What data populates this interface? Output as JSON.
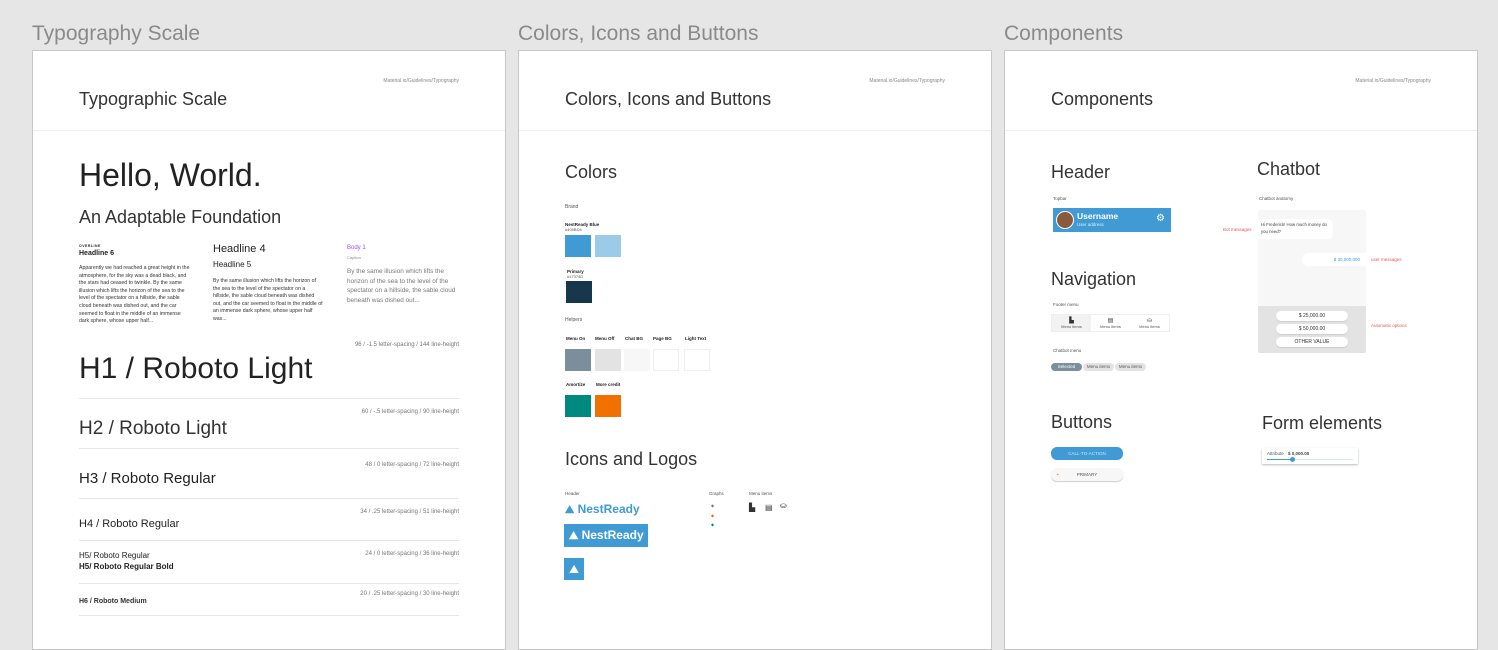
{
  "sections": [
    "Typography Scale",
    "Colors, Icons and Buttons",
    "Components"
  ],
  "typography": {
    "path": "Material.io/Guidelines/Typography",
    "title": "Typographic Scale",
    "hello": "Hello, World.",
    "subtitle": "An Adaptable Foundation",
    "col1": {
      "overline": "OVERLINE",
      "headline": "Headline 6",
      "text": "Apparently we had reached a great height in the atmosphere, for the sky was a dead black, and the stars had ceased to twinkle. By the same illusion which lifts the horizon of the sea to the level of the spectator on a hillside, the sable cloud beneath was dished out, and the car seemed to float in the middle of an immense dark sphere, whose upper half..."
    },
    "col2": {
      "h4": "Headline 4",
      "h5": "Headline 5",
      "text": "By the same illusion which lifts the horizon of the sea to the level of the spectator on a hillside, the sable cloud beneath was dished out, and the car seemed to float in the middle of an immense dark sphere, whose upper half was..."
    },
    "col3": {
      "body": "Body 1",
      "caption": "Caption",
      "text": "By the same illusion which lifts the horizon of the sea to the level of the spectator on a hillside, the sable cloud beneath was dished out..."
    },
    "scale": [
      {
        "spec": "96 / -1.5 letter-spacing / 144 line-height",
        "label": "H1 / Roboto Light"
      },
      {
        "spec": "60 / -.5 letter-spacing / 90 line-height",
        "label": "H2 / Roboto Light"
      },
      {
        "spec": "48 / 0 letter-spacing / 72 line-height",
        "label": "H3 / Roboto Regular"
      },
      {
        "spec": "34 / .25 letter-spacing / 51 line-height",
        "label": "H4 / Roboto Regular"
      },
      {
        "spec": "24 / 0 letter-spacing / 36 line-height",
        "label": "H5/ Roboto Regular",
        "label2": "H5/ Roboto Regular Bold"
      },
      {
        "spec": "20 / .25 letter-spacing / 30 line-height",
        "label": "H6 / Roboto Medium"
      }
    ]
  },
  "colors": {
    "path": "Material.io/Guidelines/Typography",
    "title": "Colors, Icons and Buttons",
    "heading": "Colors",
    "brand": "Brand",
    "blue_name": "NestReady Blue",
    "blue_hex": "#409BD4",
    "primary_name": "Primary",
    "primary_hex": "#17374D",
    "helpers": "Helpers",
    "helper_labels": [
      "Menu On",
      "Menu Off",
      "Chat BG",
      "Page BG",
      "Light Text"
    ],
    "accent_labels": [
      "Amortize",
      "More credit"
    ],
    "swatch_colors": {
      "blue": "#409bd4",
      "light_blue": "#9ccbea",
      "primary": "#17374d",
      "menu_on": "#7a8f9b",
      "menu_off": "#e3e3e3",
      "chat_bg": "#f7f7f7",
      "page_bg": "#ffffff",
      "light_text": "#ffffff",
      "amortize": "#00897f",
      "more_credit": "#f07000"
    },
    "icons_heading": "Icons and Logos",
    "header_label": "Header",
    "graphs_label": "Graphs",
    "menu_items_label": "Menu items",
    "logo": "NestReady"
  },
  "components": {
    "path": "Material.io/Guidelines/Typography",
    "title": "Components",
    "header": "Header",
    "topbar": "Topbar",
    "username": "Username",
    "user_address": "User address",
    "bot_messages": "Bot messages",
    "navigation": "Navigation",
    "footer_menu": "Footer menu",
    "footer_items": [
      "Menu items",
      "Menu items",
      "Menu items"
    ],
    "chatbot_menu": "Chatbot menu",
    "chatbot_items": [
      "Selected",
      "Menu items",
      "Menu items"
    ],
    "chatbot": "Chatbot",
    "anatomy": "Chatbot anatomy",
    "bot_text": "Hi Frederick! How much money do you need?",
    "user_msg": "$ 30,000,000",
    "user_messages": "user messages",
    "options": [
      "$ 25,000.00",
      "$ 50,000.00",
      "OTHER VALUE"
    ],
    "automatic_options": "Automatic options",
    "buttons": "Buttons",
    "cta": "CALL-TO-ACTION",
    "primary": "PRIMARY",
    "form_elements": "Form elements",
    "attribute": "Attribute",
    "attribute_value": "$ 0,000.00",
    "slider_value": 0.3
  }
}
